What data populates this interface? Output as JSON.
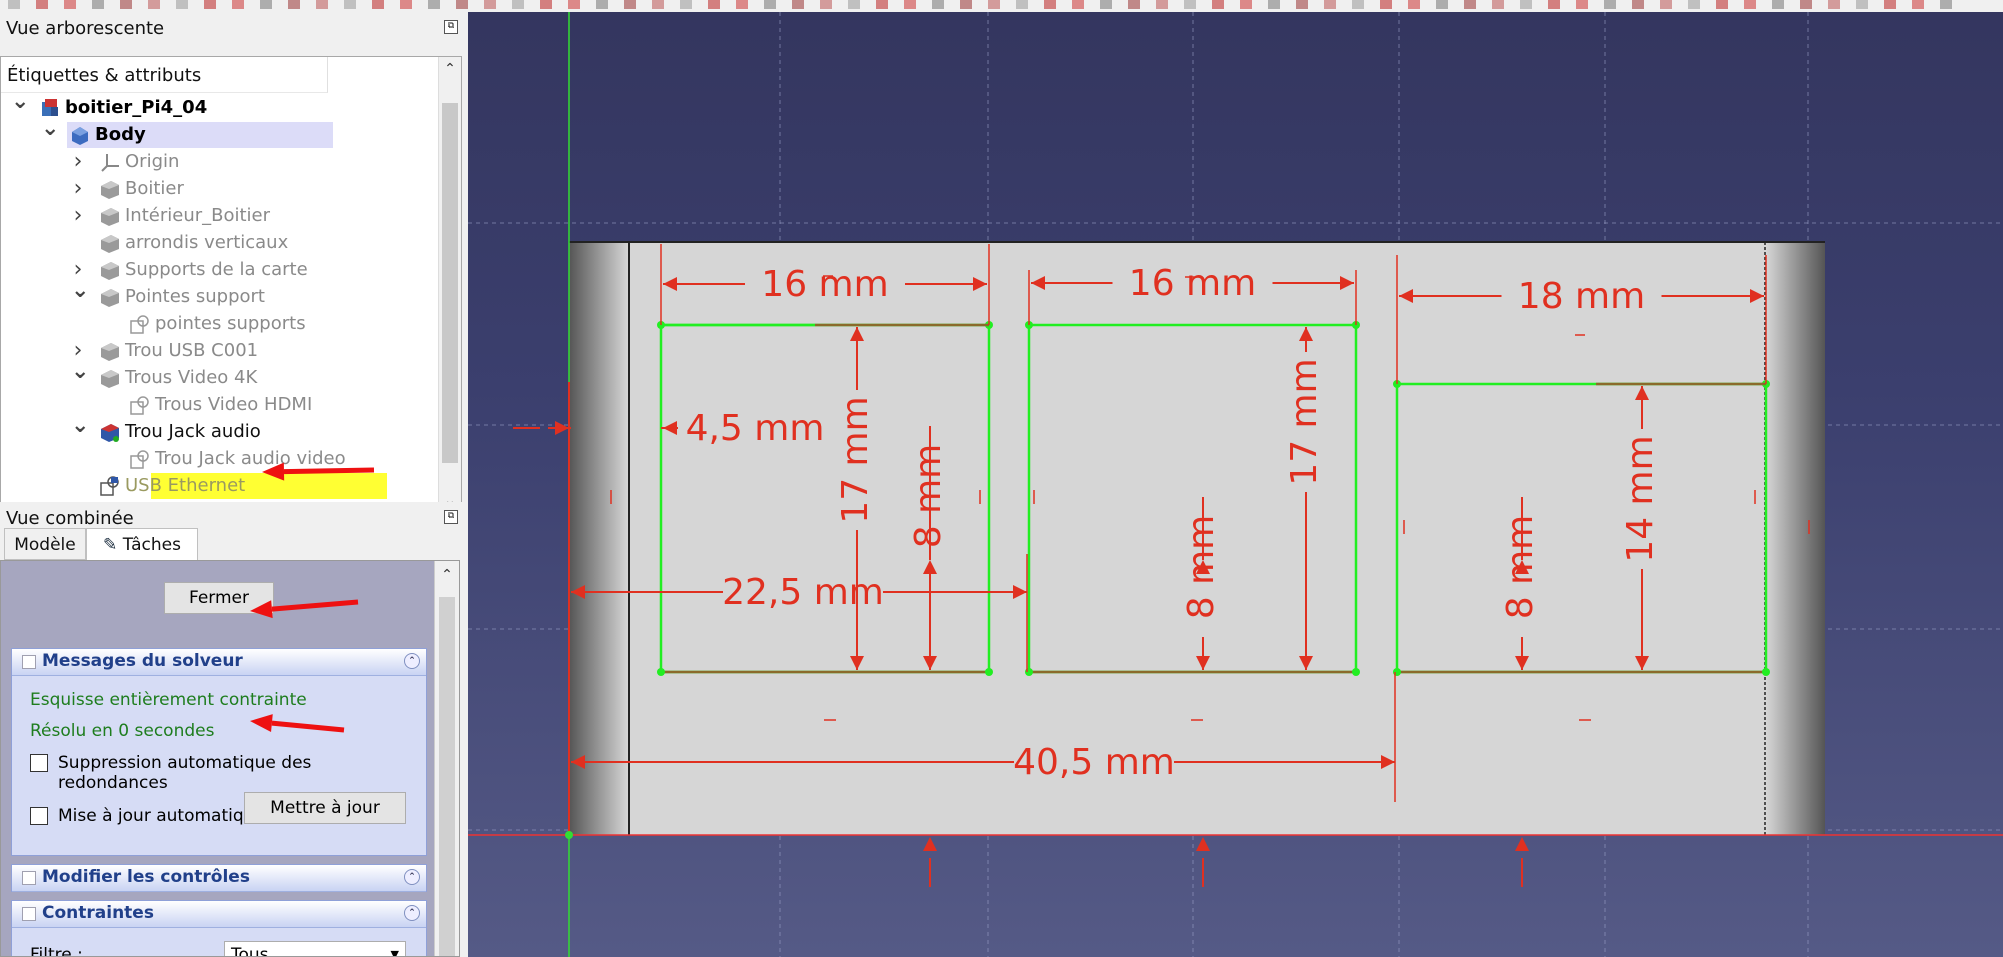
{
  "tree_panel": {
    "title": "Vue arborescente",
    "column_header": "Étiquettes & attributs",
    "items": [
      {
        "label": "boitier_Pi4_04",
        "style": "bold"
      },
      {
        "label": "Body",
        "style": "bold"
      },
      {
        "label": "Origin",
        "style": "grey"
      },
      {
        "label": "Boitier",
        "style": "grey"
      },
      {
        "label": "Intérieur_Boitier",
        "style": "grey"
      },
      {
        "label": "arrondis verticaux",
        "style": "grey"
      },
      {
        "label": "Supports de la carte",
        "style": "grey"
      },
      {
        "label": "Pointes support",
        "style": "grey"
      },
      {
        "label": "pointes supports",
        "style": "grey"
      },
      {
        "label": "Trou USB C001",
        "style": "grey"
      },
      {
        "label": "Trous Video 4K",
        "style": "grey"
      },
      {
        "label": "Trous Video HDMI",
        "style": "grey"
      },
      {
        "label": "Trou Jack audio",
        "style": "dark"
      },
      {
        "label": "Trou Jack audio video",
        "style": "grey"
      },
      {
        "label": "USB Ethernet",
        "style": "highlight"
      }
    ],
    "highlight_color": "#ffff33",
    "selected_color": "#dcdcf8"
  },
  "combined_panel": {
    "title": "Vue combinée",
    "tabs": [
      {
        "label": "Modèle",
        "active": false
      },
      {
        "label": "Tâches",
        "active": true
      }
    ],
    "close_button": "Fermer",
    "solver_box": {
      "title": "Messages du solveur",
      "status_line1": "Esquisse entièrement contrainte",
      "status_line2": "Résolu en 0 secondes",
      "auto_remove_label": "Suppression automatique des redondances",
      "auto_update_label": "Mise à jour automatique",
      "update_button": "Mettre à jour"
    },
    "controls_box": {
      "title": "Modifier les contrôles"
    },
    "constraints_box": {
      "title": "Contraintes",
      "filter_label": "Filtre :",
      "filter_value": "Tous"
    }
  },
  "sketch": {
    "dimensions": {
      "d1": "16 mm",
      "d2": "16 mm",
      "d3": "18 mm",
      "d4": "4,5 mm",
      "d5": "17 mm",
      "d6": "8 mm",
      "d7": "17 mm",
      "d8": "8 mm",
      "d9": "14 mm",
      "d10": "8 mm",
      "d11": "22,5 mm",
      "d12": "40,5 mm"
    },
    "colors": {
      "constraint": "#e03020",
      "geometry": "#22ee22",
      "annotation_arrow": "#ee1111",
      "background_top": "#34365f",
      "background_bottom": "#555a86"
    }
  }
}
